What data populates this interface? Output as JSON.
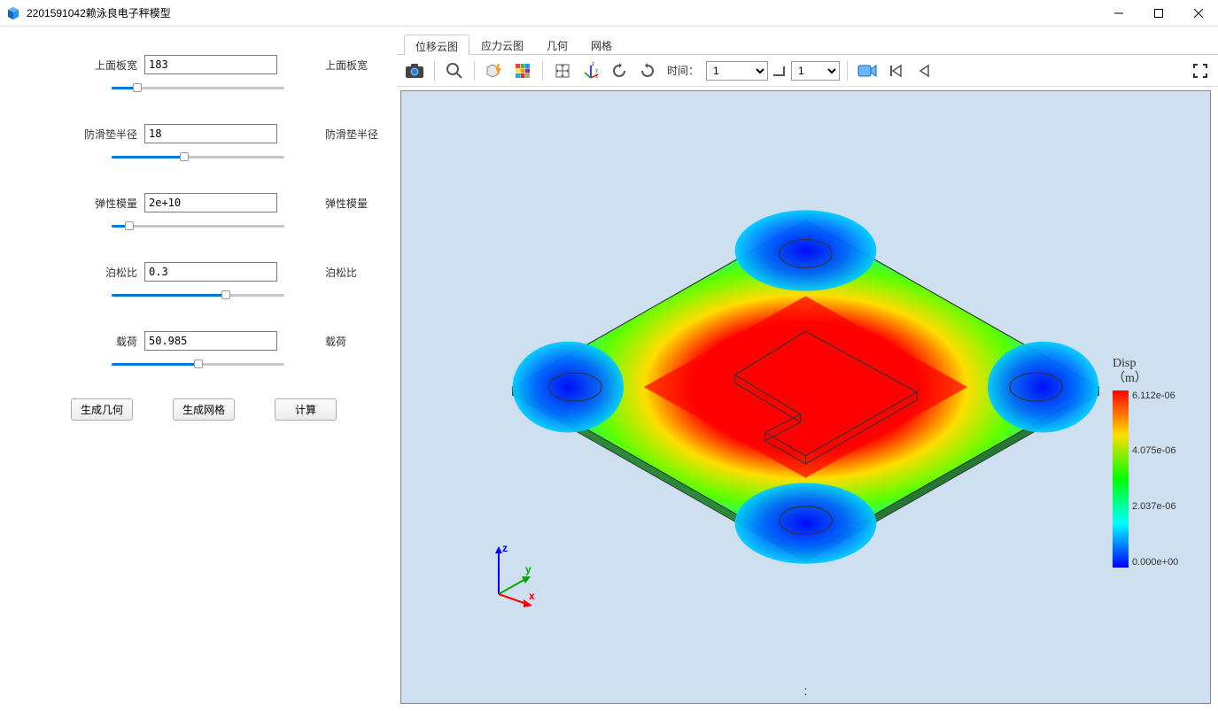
{
  "window": {
    "title": "2201591042赖泳良电子秤模型"
  },
  "params": [
    {
      "label": "上面板宽",
      "value": "183",
      "right_label": "上面板宽",
      "slider_pct": 15
    },
    {
      "label": "防滑垫半径",
      "value": "18",
      "right_label": "防滑垫半径",
      "slider_pct": 42
    },
    {
      "label": "弹性模量",
      "value": "2e+10",
      "right_label": "弹性模量",
      "slider_pct": 10
    },
    {
      "label": "泊松比",
      "value": "0.3",
      "right_label": "泊松比",
      "slider_pct": 66
    },
    {
      "label": "载荷",
      "value": "50.985",
      "right_label": "载荷",
      "slider_pct": 50
    }
  ],
  "buttons": {
    "gen_geometry": "生成几何",
    "gen_mesh": "生成网格",
    "compute": "计算"
  },
  "tabs": [
    {
      "label": "位移云图",
      "active": true
    },
    {
      "label": "应力云图",
      "active": false
    },
    {
      "label": "几何",
      "active": false
    },
    {
      "label": "网格",
      "active": false
    }
  ],
  "toolbar": {
    "time_label": "时间：",
    "time_combo1": "1",
    "time_combo2": "1"
  },
  "legend": {
    "title_line1": "Disp",
    "title_line2": "（m）",
    "ticks": [
      "6.112e-06",
      "4.075e-06",
      "2.037e-06",
      "0.000e+00"
    ]
  },
  "status_dots": ":",
  "axis": {
    "x": "x",
    "y": "y",
    "z": "z"
  },
  "chart_data": {
    "type": "heatmap",
    "title": "Disp (m)",
    "variable": "Displacement magnitude",
    "unit": "m",
    "colorscale": [
      {
        "value": 0.0,
        "color": "#0000ff"
      },
      {
        "value": 2.037e-06,
        "color": "#00ffff"
      },
      {
        "value": 4.075e-06,
        "color": "#ffff00"
      },
      {
        "value": 6.112e-06,
        "color": "#ff0000"
      }
    ],
    "range": [
      0.0,
      6.112e-06
    ],
    "description": "FEA displacement contour on a square top plate with four circular anti-slip pads near corners; maximum displacement (~6.1e-06 m) at plate center, near-zero at pad supports."
  }
}
